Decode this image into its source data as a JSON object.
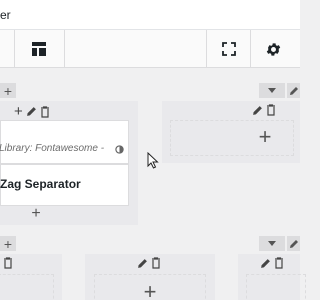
{
  "titlebar": {
    "title": "er"
  },
  "layout": {
    "library_meta": "Library: Fontawesome -",
    "separator_label": "Zag Separator"
  },
  "icons": {
    "layout": "layout-icon",
    "fullscreen": "fullscreen-icon",
    "settings": "gear-icon",
    "plus": "plus-icon",
    "edit": "pencil-icon",
    "delete": "trash-icon",
    "move": "chevron-down-icon",
    "cursor": "cursor-arrow-icon"
  },
  "colors": {
    "page_bg": "#f0f0f1",
    "panel_bg": "#e9e9ec",
    "card_bg": "#ffffff",
    "accent": "#1d2327"
  }
}
